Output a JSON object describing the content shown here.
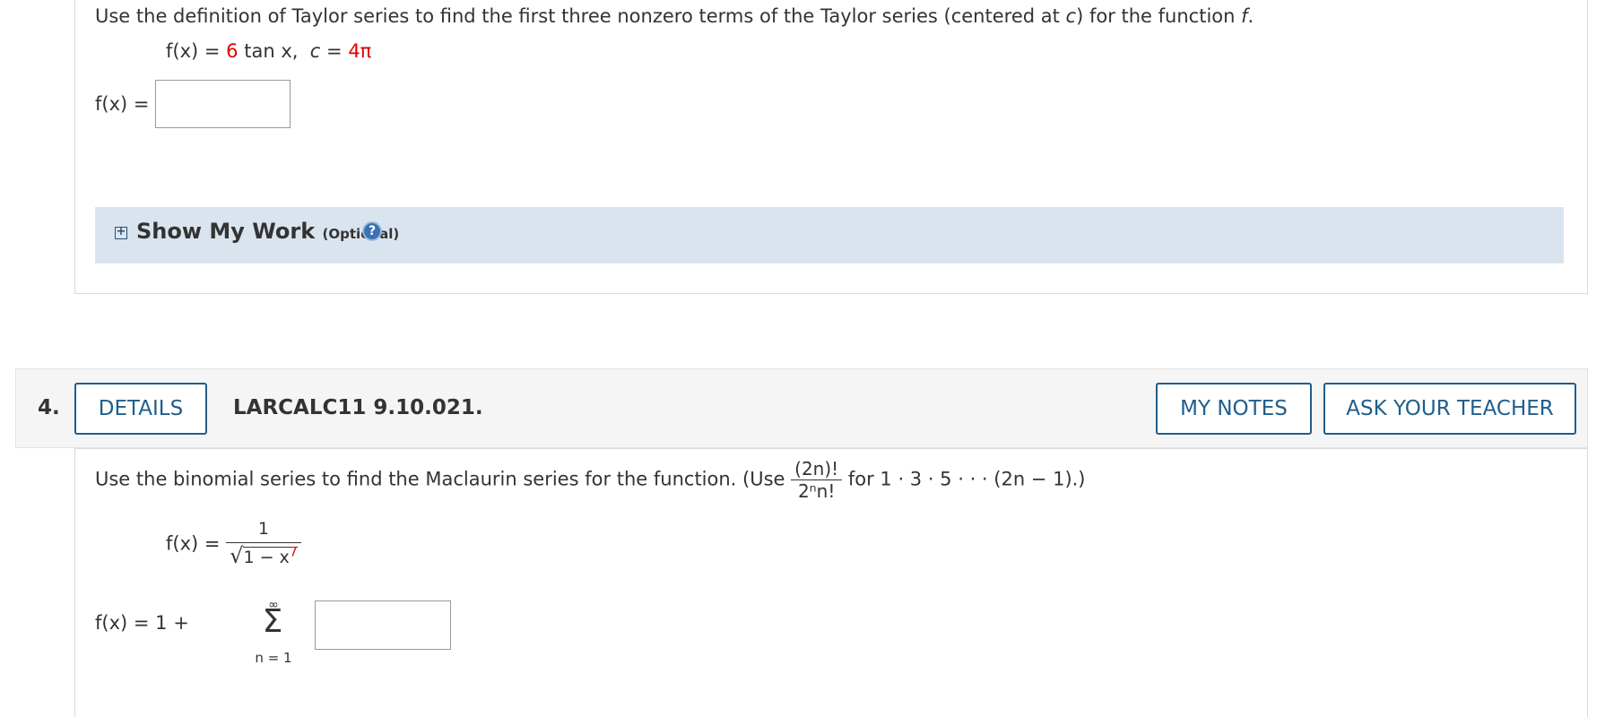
{
  "q3": {
    "prompt_pre": "Use the definition of Taylor series to find the first three nonzero terms of the Taylor series (centered at",
    "prompt_c": "c",
    "prompt_mid": ") for the function",
    "prompt_f": "f",
    "prompt_end": ".",
    "func_lhs": "f(x) =",
    "func_coeff": "6",
    "func_rest": "tan x,",
    "c_label": "c =",
    "c_value": "4π",
    "answer_label": "f(x) =",
    "answer_value": "",
    "show_my_work": {
      "title": "Show My Work",
      "optional": "(Optional)",
      "help_glyph": "?"
    }
  },
  "q4": {
    "number": "4.",
    "details_label": "DETAILS",
    "code": "LARCALC11 9.10.021.",
    "my_notes_label": "MY NOTES",
    "ask_teacher_label": "ASK YOUR TEACHER",
    "prompt_pre": "Use the binomial series to find the Maclaurin series for the function. (Use",
    "hint_num": "(2n)!",
    "hint_den": "2ⁿn!",
    "prompt_post": "for 1 · 3 · 5 · · · (2n − 1).)",
    "func_lhs": "f(x) =",
    "func_num": "1",
    "func_den_pre": "1 − x",
    "func_exp": "7",
    "answer_lhs": "f(x) = 1 +",
    "sum_top": "∞",
    "sum_symbol": "Σ",
    "sum_bottom": "n = 1",
    "answer_value": ""
  }
}
